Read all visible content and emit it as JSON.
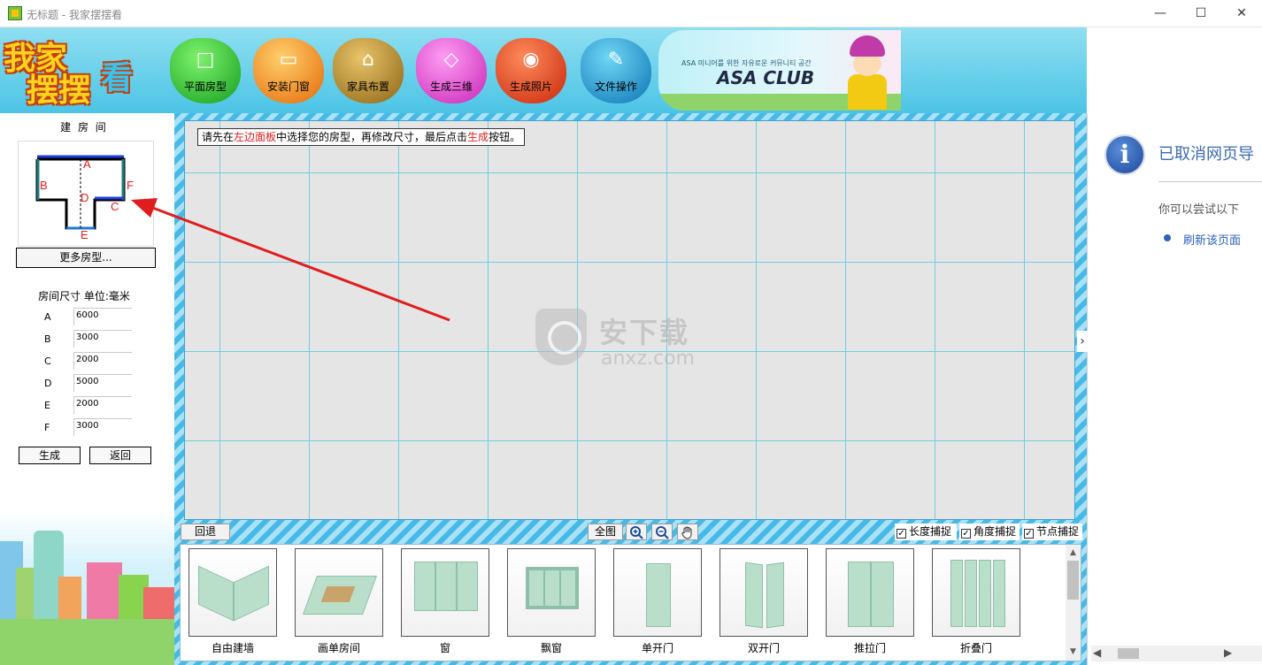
{
  "window": {
    "title": "无标题 - 我家摆摆看",
    "minimize": "—",
    "maximize": "☐",
    "close": "✕"
  },
  "logo": {
    "line1": "我家",
    "line2": "摆摆",
    "line3": "看"
  },
  "toolbar": [
    {
      "label": "平面房型",
      "icon": "square-outline-icon",
      "glyph": "□"
    },
    {
      "label": "安装门窗",
      "icon": "window-frame-icon",
      "glyph": "▭"
    },
    {
      "label": "家具布置",
      "icon": "furniture-icon",
      "glyph": "⌂"
    },
    {
      "label": "生成三维",
      "icon": "cube-icon",
      "glyph": "◇"
    },
    {
      "label": "生成照片",
      "icon": "camera-icon",
      "glyph": "◉"
    },
    {
      "label": "文件操作",
      "icon": "wrench-icon",
      "glyph": "✎"
    }
  ],
  "banner": {
    "subtitle": "ASA 미니어를 위한 자유로운 커뮤니티 공간",
    "title": "ASA CLUB"
  },
  "left_panel": {
    "title": "建 房 间",
    "preview_labels": [
      "A",
      "B",
      "C",
      "D",
      "E",
      "F"
    ],
    "more_button": "更多房型...",
    "size_title": "房间尺寸 单位:毫米",
    "dimensions": [
      {
        "label": "A",
        "value": "6000"
      },
      {
        "label": "B",
        "value": "3000"
      },
      {
        "label": "C",
        "value": "2000"
      },
      {
        "label": "D",
        "value": "5000"
      },
      {
        "label": "E",
        "value": "2000"
      },
      {
        "label": "F",
        "value": "3000"
      }
    ],
    "generate_button": "生成",
    "back_button": "返回"
  },
  "canvas": {
    "hint": {
      "p1": "请先在",
      "p2": "左边面板",
      "p3": "中选择您的房型，再修改尺寸，最后点击",
      "p4": "生成",
      "p5": "按钮。"
    },
    "watermark": {
      "text": "安下载",
      "url": "anxz.com"
    }
  },
  "bottom_bar": {
    "undo": "回退",
    "fit": "全图",
    "zoom_in_icon": "zoom-in-icon",
    "zoom_out_icon": "zoom-out-icon",
    "pan_icon": "hand-icon",
    "checks": [
      {
        "label": "长度捕捉",
        "checked": true,
        "mark": "✓"
      },
      {
        "label": "角度捕捉",
        "checked": true,
        "mark": "✓"
      },
      {
        "label": "节点捕捉",
        "checked": true,
        "mark": "✓"
      }
    ]
  },
  "library": [
    {
      "label": "自由建墙"
    },
    {
      "label": "画单房间"
    },
    {
      "label": "窗"
    },
    {
      "label": "飘窗"
    },
    {
      "label": "单开门"
    },
    {
      "label": "双开门"
    },
    {
      "label": "推拉门"
    },
    {
      "label": "折叠门"
    }
  ],
  "right_pane": {
    "icon": "info-icon",
    "icon_glyph": "i",
    "title": "已取消网页导",
    "try_text": "你可以尝试以下",
    "refresh_link": "刷新该页面",
    "chevron": "›"
  },
  "colors": {
    "accent_red": "#e01d1d",
    "link_blue": "#2b62b9",
    "grid": "#6ecfe0",
    "canvas_bg": "#e5e5e5"
  }
}
